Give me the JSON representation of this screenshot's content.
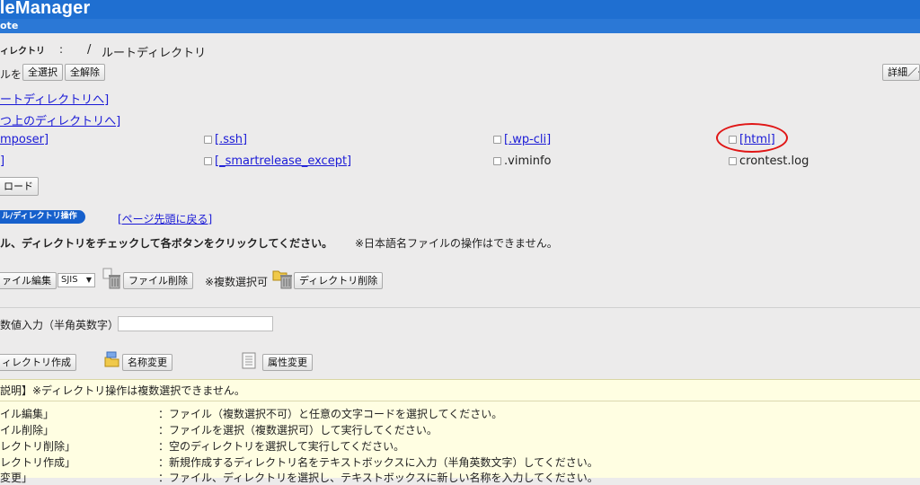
{
  "header": {
    "brand": "ileManager",
    "subtitle": "ote"
  },
  "breadcrumb": {
    "label": "ィレクトリ",
    "colon": ":",
    "separator": "/",
    "current": "ルートディレクトリ"
  },
  "selection": {
    "prefix": "ルを",
    "select_all": "全選択",
    "deselect_all": "全解除",
    "detail_button": "詳細／ー"
  },
  "nav_links": {
    "root": "ートディレクトリへ]",
    "parent": "つ上のディレクトリへ]"
  },
  "files": {
    "composer": "mposer]",
    "row2_col1": "]",
    "ssh": "[.ssh]",
    "wpcli": "[.wp-cli]",
    "html": "[html]",
    "smartrelease": "[_smartrelease_except]",
    "viminfo": ".viminfo",
    "crontest": "crontest.log"
  },
  "upload_button": "ロード",
  "ops": {
    "pill_label": "ル/ディレクトリ操作",
    "back_to_top": "[ページ先頭に戻る]",
    "instruction": "ル、ディレクトリをチェックして各ボタンをクリックしてください。",
    "note": "※日本語名ファイルの操作はできません。",
    "file_edit": "ァイル編集",
    "encoding": "SJIS",
    "file_delete": "ファイル削除",
    "multi_select_note": "※複数選択可",
    "dir_delete": "ディレクトリ削除",
    "value_input_label": "数値入力（半角英数字）",
    "dir_create": "ィレクトリ作成",
    "rename": "名称変更",
    "attr_change": "属性変更"
  },
  "info": {
    "title": "説明】※ディレクトリ操作は複数選択できません。",
    "rows": [
      {
        "key": "イル編集」",
        "desc": "：ファイル（複数選択不可）と任意の文字コードを選択してください。"
      },
      {
        "key": "イル削除」",
        "desc": "：ファイルを選択（複数選択可）して実行してください。"
      },
      {
        "key": "レクトリ削除」",
        "desc": "：空のディレクトリを選択して実行してください。"
      },
      {
        "key": "レクトリ作成」",
        "desc": "：新規作成するディレクトリ名をテキストボックスに入力（半角英数文字）してください。"
      },
      {
        "key": "変更」",
        "desc": "：ファイル、ディレクトリを選択し、テキストボックスに新しい名称を入力してください。"
      }
    ]
  },
  "colors": {
    "header_blue": "#1f6fd1",
    "link_blue": "#1a1ad6",
    "highlight_red": "#e01616",
    "info_bg": "#fffee2"
  }
}
